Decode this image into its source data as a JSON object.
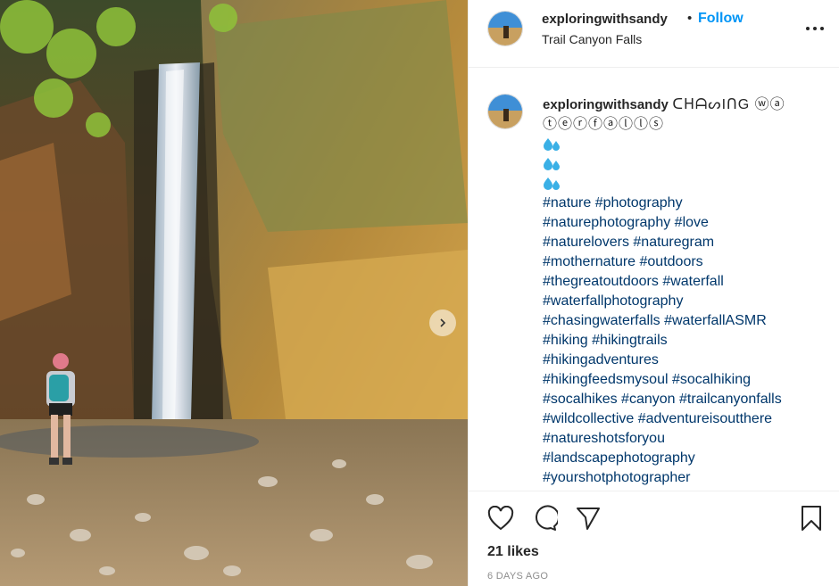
{
  "post": {
    "username": "exploringwithsandy",
    "separator": "•",
    "follow_label": "Follow",
    "location": "Trail Canyon Falls",
    "caption_title": "ᑕᕼᗩᔕIᑎG ⓦⓐⓣⓔⓡⓕⓐⓛⓛⓢ",
    "caption_title_line1": "ᑕᕼᗩᔕIᑎG ⓦⓐ",
    "caption_title_line2": "ⓣⓔⓡⓕⓐⓛⓛⓢ",
    "drop_icon": "water-drops-icon",
    "hashtag_lines": [
      "#nature #photography",
      "#naturephotography #love",
      "#naturelovers #naturegram",
      "#mothernature #outdoors",
      "#thegreatoutdoors #waterfall",
      "#waterfallphotography",
      "#chasingwaterfalls #waterfallASMR",
      "#hiking #hikingtrails",
      "#hikingadventures",
      "#hikingfeedsmysoul #socalhiking",
      "#socalhikes #canyon #trailcanyonfalls",
      "#wildcollective #adventureisoutthere",
      "#natureshotsforyou",
      "#landscapephotography",
      "#yourshotphotographer"
    ],
    "likes": "21 likes",
    "timestamp": "6 DAYS AGO"
  },
  "icons": {
    "like": "heart-icon",
    "comment": "comment-bubble-icon",
    "share": "paper-plane-icon",
    "save": "bookmark-icon",
    "more": "more-options-icon",
    "next": "chevron-right-icon"
  },
  "colors": {
    "link": "#00376b",
    "follow": "#0095f6",
    "muted": "#8e8e8e",
    "drop": "#3ab0e6"
  }
}
